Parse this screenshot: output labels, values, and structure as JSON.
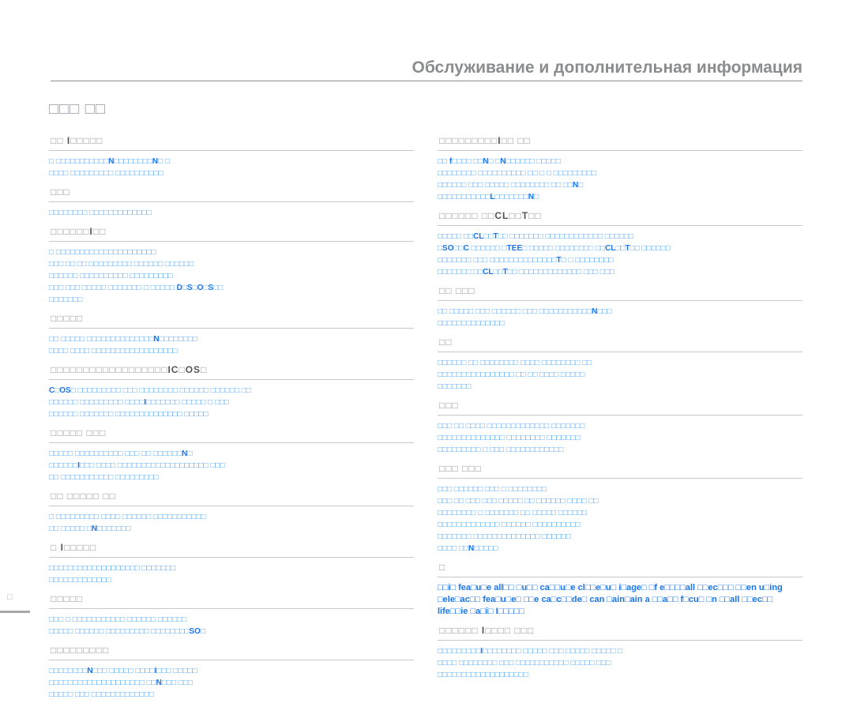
{
  "header": {
    "title": "Обслуживание и дополнительная информация"
  },
  "page_heading": "□□□ □□",
  "page_number": "□",
  "left_column": [
    {
      "title": "□□ I□□□□□",
      "lines": [
        "□ □□□□□□□□□□□N□□□□□□□□N□ □",
        "□□□□ □□□□□□□□□ □□□□□□□□□□"
      ]
    },
    {
      "title": "□□□",
      "lines": [
        "□□□□□□□□ □□□□□□□□□□□□□"
      ]
    },
    {
      "title": "□□□□□□I□□",
      "lines": [
        "□ □□□□□□□□□□□□□□□□□□□□□",
        "□□□ □□ □□ □□□□□□□□□ □□□□□□ □□□□□□",
        "□□□□□□ □□□□□□□□□□ □□□□□□□□□",
        "□□□ □□□ □□□□□ □□□□□□□ □ □□□□□ D□S□O□S□□",
        "□□□□□□□"
      ]
    },
    {
      "title": "□□□□□",
      "lines": [
        "□□ □□□□□ □□□□□□□□□□□□□□N□□□□□□□□",
        "□□□□ □□□□ □□□□□□□□□□□□□□□□□□"
      ]
    },
    {
      "title": "□□□□□□□□□□□□□□□□□□IC□OS□",
      "lines": [
        "C□OS□ □□□□□□□□□ □□□ □□□□□□□□ □□□□□□ □□□□□□ □□",
        "□□□□□□ □□□□□□□□□ □□□□I□□□□□□□ □□□□□ □ □□□",
        "□□□□□□ □□□□□□□ □□□□□□□□□□□□□□ □□□□□"
      ]
    },
    {
      "title": "□□□□□ □□□",
      "lines": [
        "□□□□□ □□□□□□□□□□ □□□ □□ □□□□□□N□",
        "□□□□□□I□□□ □□□□ □□□□□□□□□□□□□□□□□□□ □□□",
        "□□ □□□□□□□□□□□ □□□□□□□□□"
      ]
    },
    {
      "title": "□□ □□□□□ □□",
      "lines": [
        "□ □□□□□□□□□ □□□□ □□□□□□ □□□□□□□□□□□",
        "□□ □□□□□ □N□□□□□□□"
      ]
    },
    {
      "title": "□ I□□□□□",
      "lines": [
        "□□□□□□□□□□□□□□□□□□□ □□□□□□□",
        "□□□□□□□□□□□□□"
      ]
    },
    {
      "title": "□□□□□",
      "lines": [
        "□□□ □ □□□□□□□□□□□ □□□□□□ □□□□□□",
        "□□□□□ □□□□□□ □□□□□□□□□ □□□□□□□□SO□"
      ]
    },
    {
      "title": "□□□□□□□□□",
      "lines": [
        "□□□□□□□□N□□□ □□□□□ □□□□I□□□ □□□□□",
        "□□□□□□□□□□□□□□□□□□□□ □□N□□□ □□□",
        "□□□□□ □□□ □□□□□□□□□□□□□"
      ]
    }
  ],
  "right_column": [
    {
      "title": "□□□□□□□□□I□□ □□",
      "lines": [
        "□□ f□□□□ □□N□ □N□□□□□□ □□□□□",
        "□□□□□□□□ □□□□□□□□□□ □□ □ □ □□□□□□□□□",
        "□□□□□□ □□□ □□□□□ □□□□□□□□ □□ □□N□",
        "□□□□□□□□□□□L□□□□□□□N□"
      ]
    },
    {
      "title": "□□□□□□ □□CL□□T□□",
      "lines": [
        "□□□□□ □□CL□□T□□ □□□□□□□ □□□□□□□□□□□□ □□□□□□",
        "□SO□□C □□□□□□ □TEE□ □□□□□ □□□□□□□□ □□CL□□T□□ □□□□□□",
        "□□□□□□□ □□□ □□□□□□□□□□□□□□T□ □ □□□□□□□□",
        "□□□□□□□ □□CL□□T□□ □□□□□□□□□□□□□ □□□ □□□"
      ]
    },
    {
      "title": "□□ □□□",
      "lines": [
        "□□ □□□□□ □□□ □□□□□□ □□□ □□□□□□□□□□□N□□□",
        "□□□□□□□□□□□□□□"
      ]
    },
    {
      "title": "□□",
      "lines": [
        "□□□□□□ □□ □□□□□□□□ □□□□ □□□□□□□□ □□",
        "□□□□□□□□□□□□□□□□ □□ □□ □□□□ □□□□□",
        "□□□□□□□"
      ]
    },
    {
      "title": "□□□",
      "lines": [
        "□□□ □□ □□□□ □□□□□□□□□□□□□ □□□□□□□",
        "□□□□□□□□□□□□□□ □□□□□□□□ □□□□□□□",
        "□□□□□□□□□ □ □□□ □□□□□□□□□□□□"
      ]
    },
    {
      "title": "□□□ □□□",
      "lines": [
        "□□□ □□□□□□ □□□ □ □□□□□□□□",
        "□□□ □□ □□□ □□□ □□□□□ □□ □□□□□□ □□□□ □□",
        "□□□□□□□□ □ □□□□□□□ □□ □□□□□ □□□□□□",
        "□□□□□□□□□□□□□ □□□□□□ □□□□□□□□□□",
        "□□□□□□□ □□□□□□□□□□□□□□ □□□□□□",
        "□□□□ □□N□□□□□"
      ]
    },
    {
      "title": "□",
      "latin": true,
      "lines": [
        "□□i□ fea□u□e all□□ □u□□ ca□□u□e cl□□e□u□ i□age□ □f e□□□□all □□ec□□□ □□en u□ing",
        "□ele□ac□□ fea□u□e□ □□e ca□c□□de□ can □ain□ain a □□a□□ f□cu□ □n □□all □□ec□□",
        "life□□ie □a□i□ I□□□□□"
      ]
    },
    {
      "title": "□□□□□□ I□□□□ □□□",
      "lines": [
        "□□□□□□□□□I□□□□□□□□ □□□□□ □□□ □□□□□ □□□□□ □",
        "□□□□ □□□□□□□□ □□□ □□□□□□□□□□□ □□□□□ □□□",
        "□□□□□□□□□□□□□□□□□□□"
      ]
    }
  ]
}
